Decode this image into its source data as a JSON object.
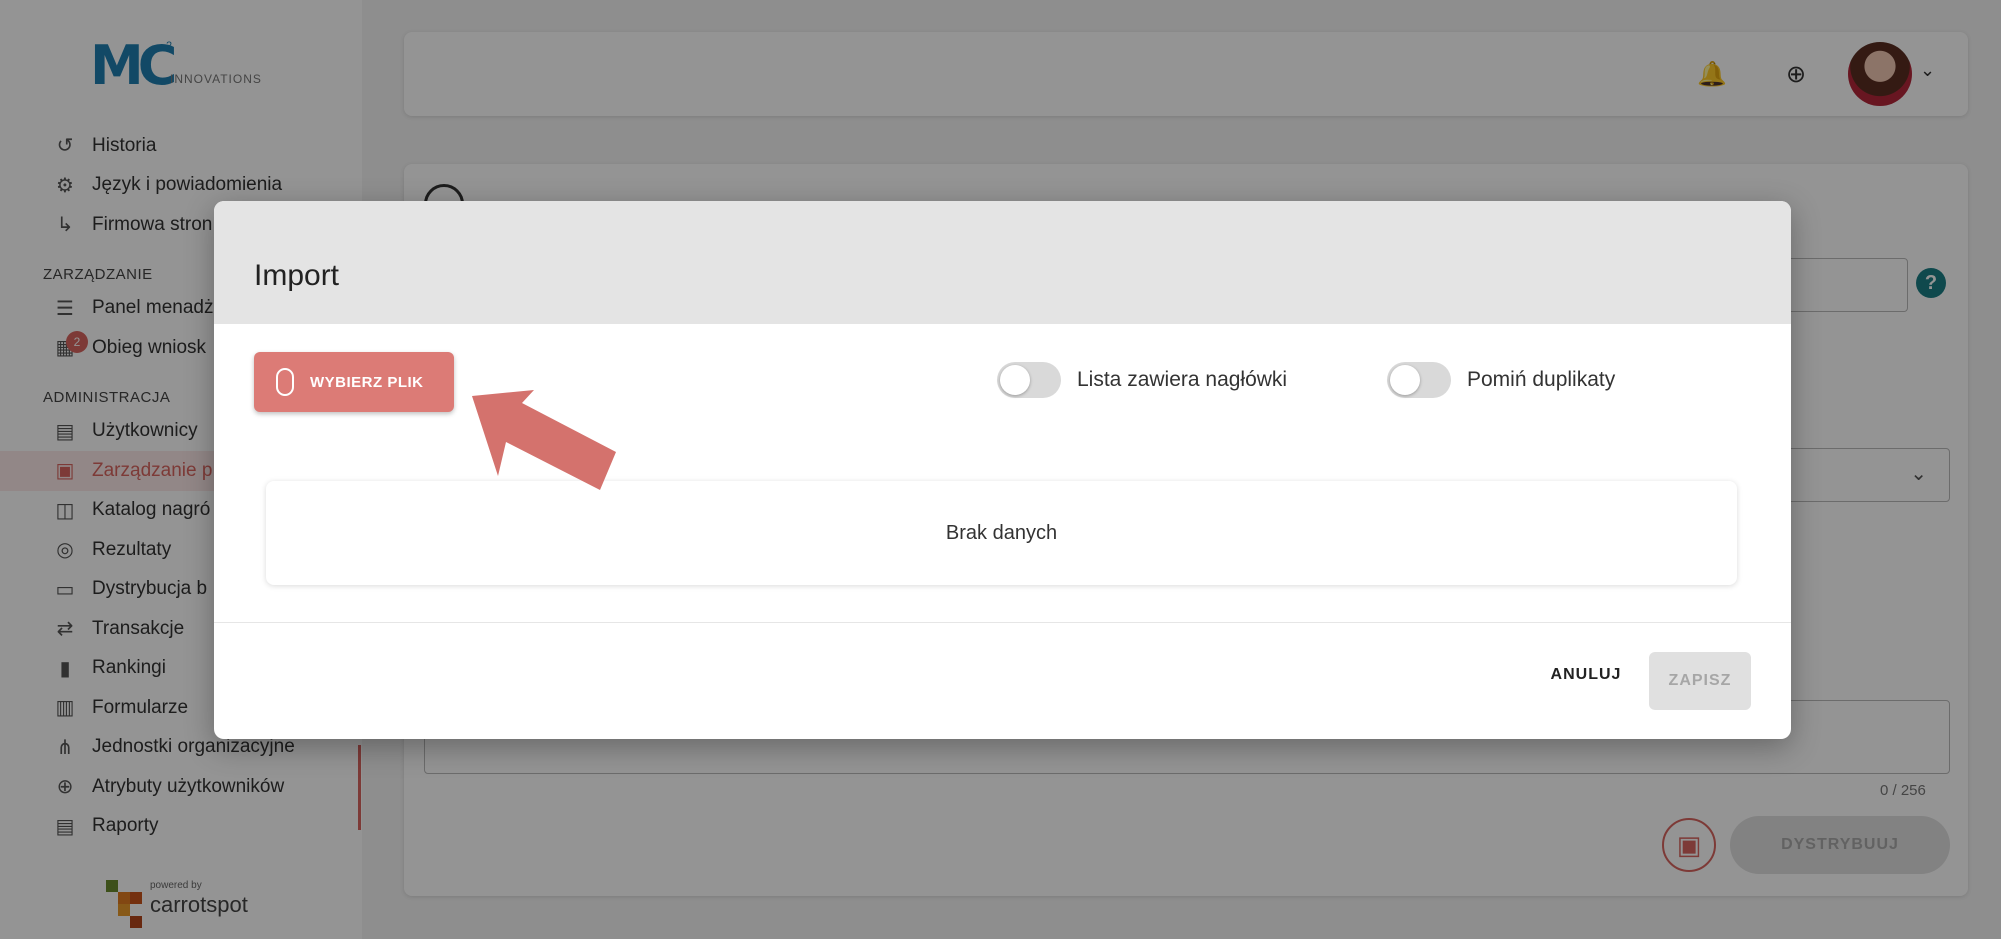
{
  "logo": {
    "text": "MC",
    "sup": "2",
    "sub": "INNOVATIONS"
  },
  "sidebar": {
    "items_top": [
      {
        "icon": "history-icon",
        "glyph": "↺",
        "label": "Historia"
      },
      {
        "icon": "gear-icon",
        "glyph": "⚙",
        "label": "Język i powiadomienia"
      },
      {
        "icon": "arrow-turn-icon",
        "glyph": "↳",
        "label": "Firmowa stron"
      }
    ],
    "section_manage": "ZARZĄDZANIE",
    "items_manage": [
      {
        "icon": "manager-panel-icon",
        "glyph": "☰",
        "label": "Panel menadż"
      },
      {
        "icon": "requests-icon",
        "glyph": "▦",
        "label": "Obieg wniosk",
        "badge": "2"
      }
    ],
    "section_admin": "ADMINISTRACJA",
    "items_admin": [
      {
        "icon": "id-card-icon",
        "glyph": "▤",
        "label": "Użytkownicy"
      },
      {
        "icon": "folder-star-icon",
        "glyph": "▣",
        "label": "Zarządzanie p",
        "active": true
      },
      {
        "icon": "bag-icon",
        "glyph": "◫",
        "label": "Katalog nagró"
      },
      {
        "icon": "target-icon",
        "glyph": "◎",
        "label": "Rezultaty"
      },
      {
        "icon": "ticket-icon",
        "glyph": "▭",
        "label": "Dystrybucja b"
      },
      {
        "icon": "transfer-icon",
        "glyph": "⇄",
        "label": "Transakcje"
      },
      {
        "icon": "bar-chart-icon",
        "glyph": "▮",
        "label": "Rankingi"
      },
      {
        "icon": "form-icon",
        "glyph": "▥",
        "label": "Formularze"
      },
      {
        "icon": "org-tree-icon",
        "glyph": "⋔",
        "label": "Jednostki organizacyjne"
      },
      {
        "icon": "user-plus-icon",
        "glyph": "⊕",
        "label": "Atrybuty użytkowników"
      },
      {
        "icon": "clipboard-icon",
        "glyph": "▤",
        "label": "Raporty"
      }
    ],
    "powered_by": "powered by",
    "powered_brand": "carrotspot"
  },
  "topbar": {
    "bell": "🔔",
    "help": "⊕",
    "chevron": "⌄"
  },
  "card": {
    "counter": "0 / 256",
    "distribute": "DYSTRYBUUJ",
    "help": "?",
    "select_chevron": "⌄",
    "calendar": "▣"
  },
  "modal": {
    "title": "Import",
    "choose_file": "WYBIERZ PLIK",
    "toggle_headers": "Lista zawiera nagłówki",
    "toggle_duplicates": "Pomiń duplikaty",
    "empty": "Brak danych",
    "cancel": "ANULUJ",
    "save": "ZAPISZ"
  },
  "colors": {
    "accent": "#dc7b76",
    "brand": "#1f7fb0",
    "teal": "#1a7f86"
  }
}
